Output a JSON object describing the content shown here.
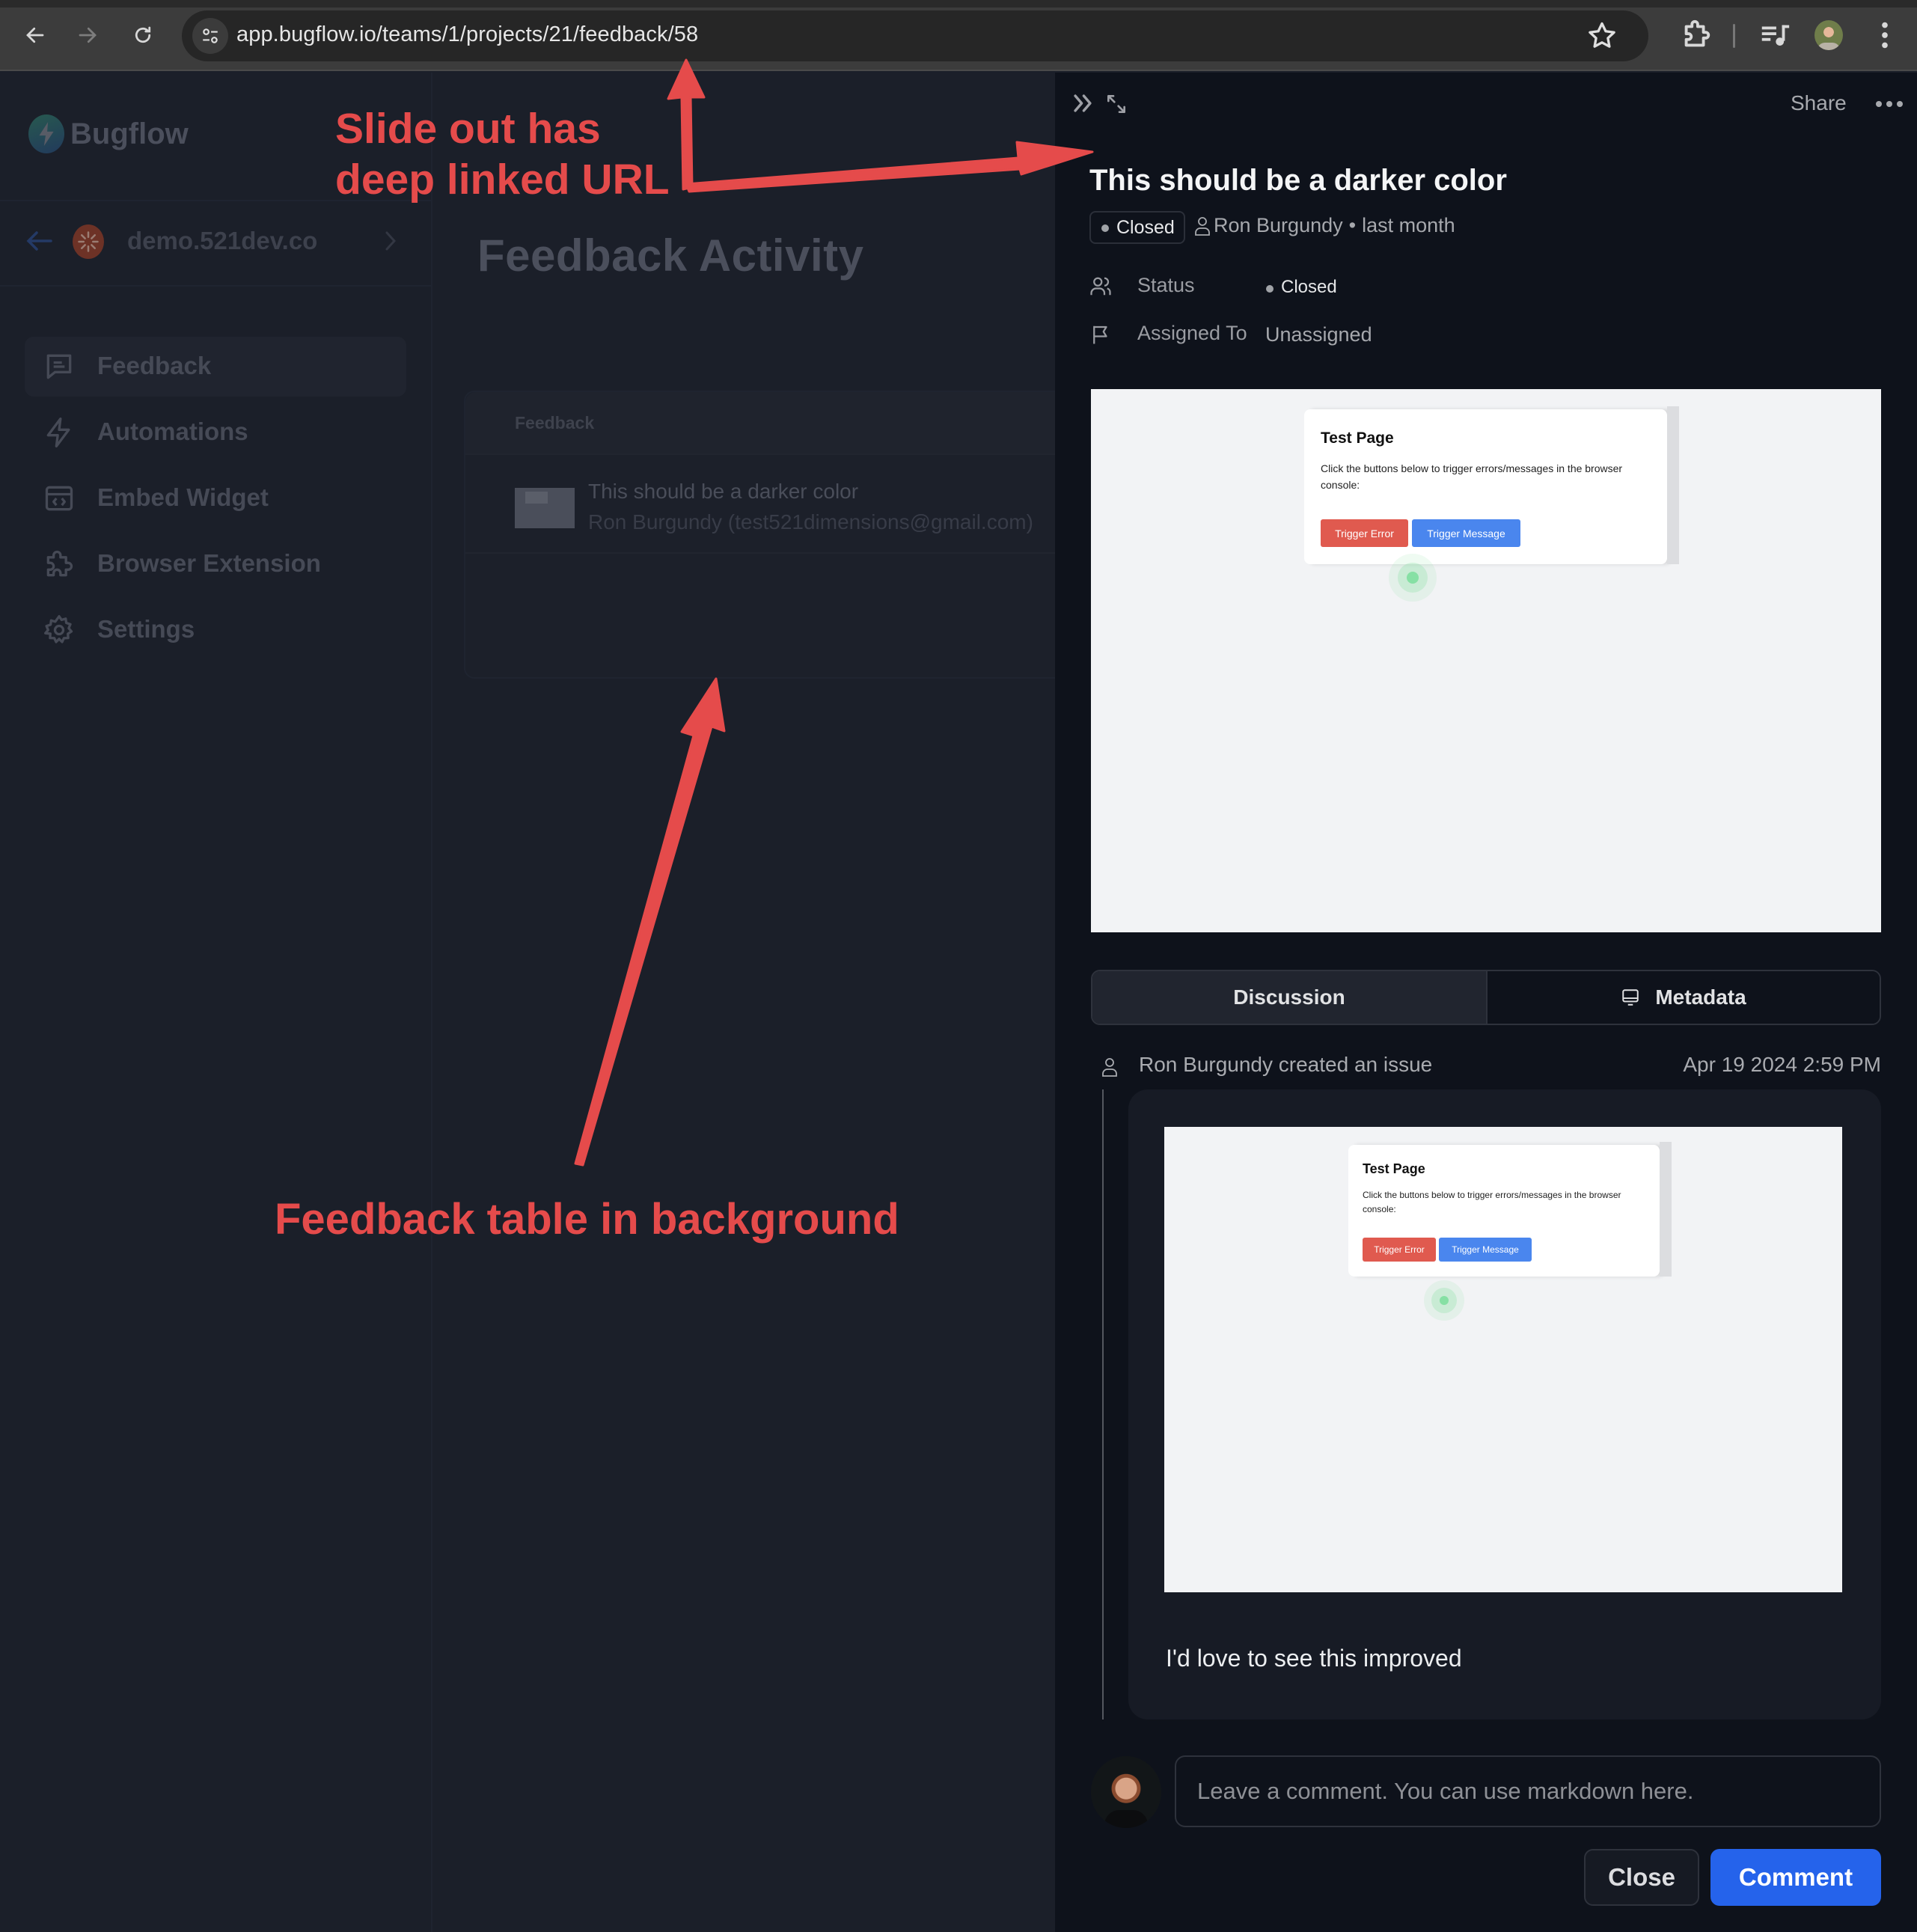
{
  "browser": {
    "url": "app.bugflow.io/teams/1/projects/21/feedback/58",
    "icons": [
      "back-arrow-icon",
      "forward-arrow-icon",
      "reload-icon",
      "site-info-icon",
      "bookmark-star-icon",
      "extensions-puzzle-icon",
      "media-controls-icon",
      "profile-avatar",
      "kebab-menu-icon"
    ]
  },
  "app": {
    "brand": "Bugflow",
    "project": {
      "name": "demo.521dev.co"
    },
    "sidebar": {
      "items": [
        {
          "label": "Feedback",
          "icon": "chat-icon",
          "active": true
        },
        {
          "label": "Automations",
          "icon": "lightning-icon",
          "active": false
        },
        {
          "label": "Embed Widget",
          "icon": "code-window-icon",
          "active": false
        },
        {
          "label": "Browser Extension",
          "icon": "puzzle-icon",
          "active": false
        },
        {
          "label": "Settings",
          "icon": "gear-icon",
          "active": false
        }
      ]
    },
    "main": {
      "title": "Feedback Activity",
      "table": {
        "columns": [
          "Feedback"
        ],
        "rows": [
          {
            "title": "This should be a darker color",
            "subtitle": "Ron Burgundy (test521dimensions@gmail.com)"
          }
        ]
      }
    }
  },
  "panel": {
    "share_label": "Share",
    "title": "This should be a darker color",
    "status_chip": "Closed",
    "author": "Ron Burgundy",
    "separator": "•",
    "time_ago": "last month",
    "properties": [
      {
        "key": "Status",
        "value": "Closed",
        "icon": "users-icon"
      },
      {
        "key": "Assigned To",
        "value": "Unassigned",
        "icon": "flag-icon"
      }
    ],
    "screenshot": {
      "heading": "Test Page",
      "body": "Click the buttons below to trigger errors/messages in the browser console:",
      "button_error": "Trigger Error",
      "button_message": "Trigger Message"
    },
    "tabs": [
      {
        "label": "Discussion",
        "active": true
      },
      {
        "label": "Metadata",
        "active": false,
        "icon": "monitor-icon"
      }
    ],
    "activity": {
      "actor_text": "Ron Burgundy created an issue",
      "timestamp": "Apr 19 2024 2:59 PM",
      "comment": "I'd love to see this improved"
    },
    "composer": {
      "placeholder": "Leave a comment. You can use markdown here.",
      "value": "",
      "close_label": "Close",
      "comment_label": "Comment"
    }
  },
  "annotations": {
    "top_line1": "Slide out has",
    "top_line2": "deep linked URL",
    "bottom": "Feedback table in background",
    "color": "#e54b4b"
  },
  "colors": {
    "accent_blue": "#2563eb",
    "panel_bg": "#0e121b",
    "backdrop_bg": "#1b1f29",
    "trigger_error": "#e05a4f",
    "trigger_message": "#4a86ee"
  }
}
